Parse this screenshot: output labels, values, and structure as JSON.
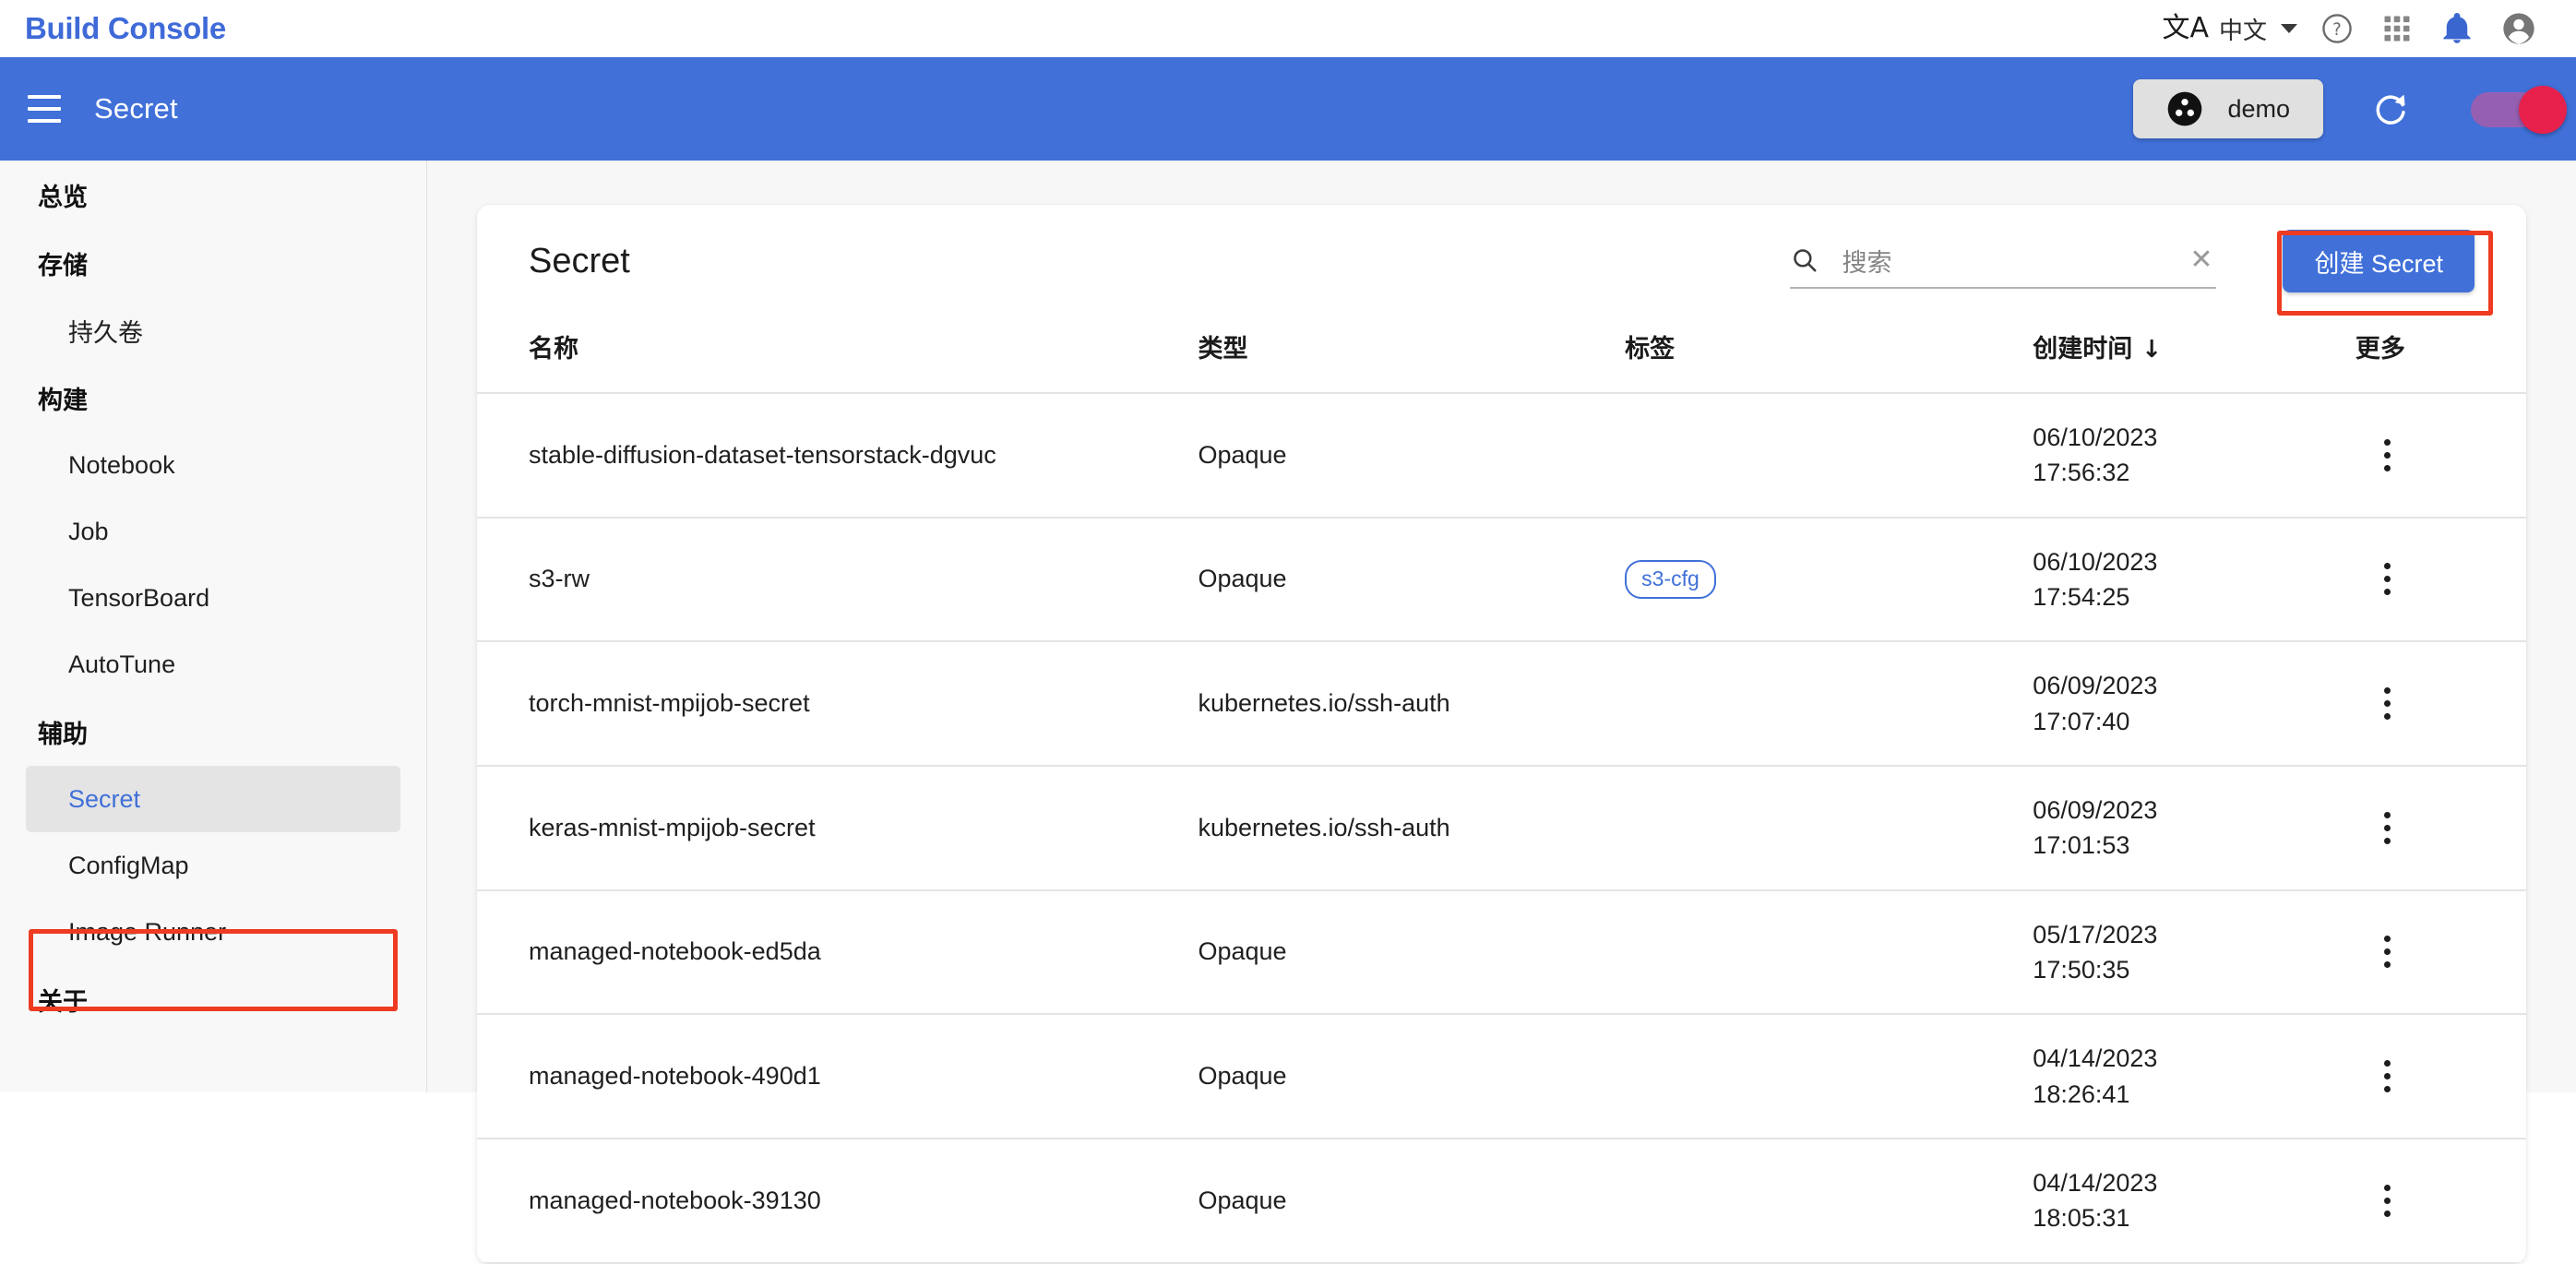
{
  "brand": {
    "title": "Build Console",
    "title_color": "#3f6ad8",
    "language_glyph": "文A",
    "language_label": "中文",
    "icons": {
      "translate": "translate-icon",
      "chevron": "chevron-down-icon",
      "help": "help-circle-icon",
      "apps": "apps-grid-icon",
      "notifications": "bell-icon",
      "account": "account-circle-icon"
    }
  },
  "appbar": {
    "title": "Secret",
    "background": "#4070d8",
    "project_chip": "demo",
    "refresh_label": "refresh-icon",
    "toggle_on": true,
    "toggle_track_color": "#9b5fb0",
    "toggle_knob_color": "#e8204c"
  },
  "sidebar": {
    "items": [
      {
        "label": "总览",
        "type": "group",
        "active": false
      },
      {
        "label": "存储",
        "type": "group",
        "active": false
      },
      {
        "label": "持久卷",
        "type": "item",
        "active": false
      },
      {
        "label": "构建",
        "type": "group",
        "active": false
      },
      {
        "label": "Notebook",
        "type": "item",
        "active": false
      },
      {
        "label": "Job",
        "type": "item",
        "active": false
      },
      {
        "label": "TensorBoard",
        "type": "item",
        "active": false
      },
      {
        "label": "AutoTune",
        "type": "item",
        "active": false
      },
      {
        "label": "辅助",
        "type": "group",
        "active": false
      },
      {
        "label": "Secret",
        "type": "item",
        "active": true
      },
      {
        "label": "ConfigMap",
        "type": "item",
        "active": false
      },
      {
        "label": "Image Runner",
        "type": "item",
        "active": false
      },
      {
        "label": "关于",
        "type": "group",
        "active": false
      }
    ]
  },
  "card": {
    "title": "Secret",
    "search": {
      "placeholder": "搜索",
      "value": "",
      "clear_glyph": "✕",
      "icon": "search-icon"
    },
    "create_button": "创建 Secret",
    "accent_color": "#4070d8",
    "annotation_color": "#ee3b21"
  },
  "table": {
    "headers": {
      "name": "名称",
      "type": "类型",
      "tag": "标签",
      "created": "创建时间",
      "sort_arrow": "↓",
      "more": "更多"
    },
    "rows": [
      {
        "name": "stable-diffusion-dataset-tensorstack-dgvuc",
        "type": "Opaque",
        "tag": "",
        "date": "06/10/2023",
        "time": "17:56:32"
      },
      {
        "name": "s3-rw",
        "type": "Opaque",
        "tag": "s3-cfg",
        "date": "06/10/2023",
        "time": "17:54:25"
      },
      {
        "name": "torch-mnist-mpijob-secret",
        "type": "kubernetes.io/ssh-auth",
        "tag": "",
        "date": "06/09/2023",
        "time": "17:07:40"
      },
      {
        "name": "keras-mnist-mpijob-secret",
        "type": "kubernetes.io/ssh-auth",
        "tag": "",
        "date": "06/09/2023",
        "time": "17:01:53"
      },
      {
        "name": "managed-notebook-ed5da",
        "type": "Opaque",
        "tag": "",
        "date": "05/17/2023",
        "time": "17:50:35"
      },
      {
        "name": "managed-notebook-490d1",
        "type": "Opaque",
        "tag": "",
        "date": "04/14/2023",
        "time": "18:26:41"
      },
      {
        "name": "managed-notebook-39130",
        "type": "Opaque",
        "tag": "",
        "date": "04/14/2023",
        "time": "18:05:31"
      }
    ]
  }
}
